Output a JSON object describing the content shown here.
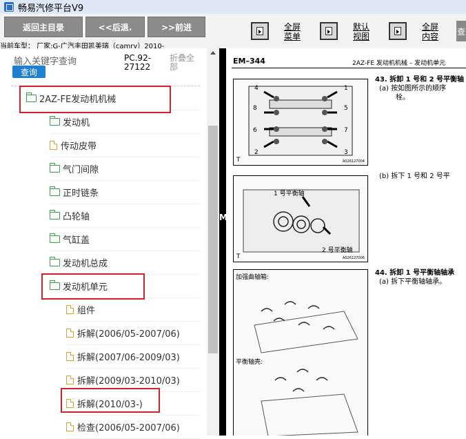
{
  "window": {
    "title": "畅易汽修平台V9"
  },
  "toolbar": {
    "back_main": "返回主目录",
    "prev": "<<后退.",
    "next": ">>前进",
    "vehicle": "当前车型： 厂家:G-广汽丰田凯美瑞（camry）2010-",
    "fullscreen_menu": [
      "全屏",
      "菜单"
    ],
    "default_view": [
      "默认",
      "视图"
    ],
    "fullscreen_content": [
      "全屏",
      "内容"
    ],
    "cut_char": "查"
  },
  "search": {
    "label": "输入关键字查询",
    "button": "查询",
    "pc_code": [
      "PC.92-",
      "27122"
    ],
    "fold_all": [
      "折叠全",
      "部"
    ]
  },
  "tree": {
    "items": [
      {
        "label": "2AZ-FE发动机机械",
        "type": "folder"
      },
      {
        "label": "发动机",
        "type": "folder"
      },
      {
        "label": "传动皮带",
        "type": "doc"
      },
      {
        "label": "气门间隙",
        "type": "folder"
      },
      {
        "label": "正时链条",
        "type": "folder"
      },
      {
        "label": "凸轮轴",
        "type": "folder"
      },
      {
        "label": "气缸盖",
        "type": "folder"
      },
      {
        "label": "发动机总成",
        "type": "folder"
      },
      {
        "label": "发动机单元",
        "type": "folder"
      },
      {
        "label": "组件",
        "type": "doc"
      },
      {
        "label": "拆解(2006/05-2007/06)",
        "type": "doc"
      },
      {
        "label": "拆解(2007/06-2009/03)",
        "type": "doc"
      },
      {
        "label": "拆解(2009/03-2010/03)",
        "type": "doc"
      },
      {
        "label": "拆解(2010/03-)",
        "type": "doc"
      },
      {
        "label": "检查(2006/05-2007/06)",
        "type": "doc"
      }
    ]
  },
  "document": {
    "page_id": "EM–344",
    "section": "2AZ-FE 发动机机械 – 发动机单元",
    "step43_title": "43.  拆卸 1 号和 2 号平衡轴",
    "step43_a": [
      "(a)  按如图所示的顺序",
      "栓。"
    ],
    "step43_b": "(b)  拆下 1 号和 2 号平",
    "step44_title": "44.  拆卸 1 号平衡轴轴承",
    "step44_a": "(a)  拆下平衡轴轴承。",
    "fig1_code": "A026127004",
    "fig2_code": "A026127006",
    "fig2_labels": [
      "1 号平衡轴",
      "2 号平衡轴"
    ],
    "fig3_labels": [
      "加强曲轴箱:",
      "平衡轴壳:"
    ],
    "fig_t": "T",
    "splitter_char": "M"
  },
  "colors": {
    "accent": "#1f7fd0",
    "highlight": "#d0242b",
    "folder": "#3aa14a",
    "doc": "#e0a030"
  }
}
